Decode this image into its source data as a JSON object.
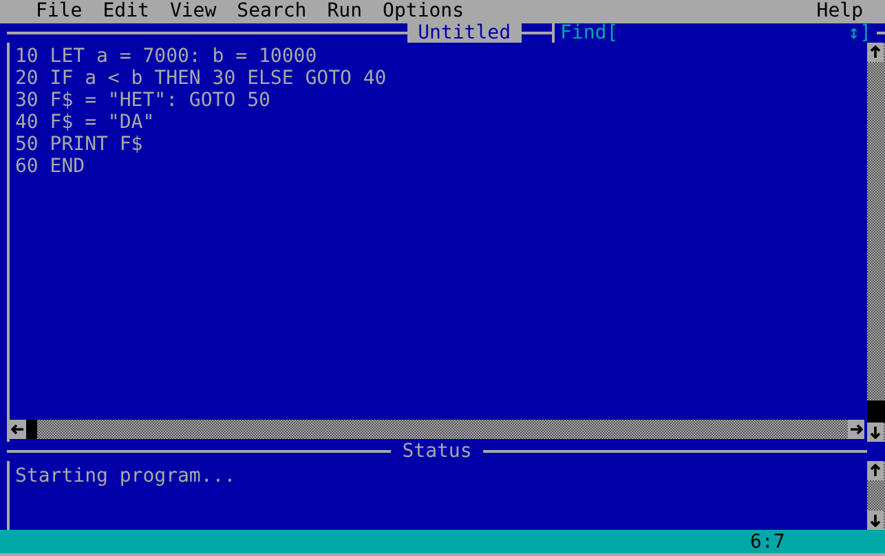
{
  "menu_bar": {
    "items": [
      "File",
      "Edit",
      "View",
      "Search",
      "Run",
      "Options"
    ],
    "help": "Help"
  },
  "editor": {
    "title": "Untitled",
    "find_label": "Find[",
    "find_end": "↕]",
    "lines": [
      "10 LET a = 7000: b = 10000",
      "20 IF a < b THEN 30 ELSE GOTO 40",
      "30 F$ = \"HET\": GOTO 50",
      "40 F$ = \"DA\"",
      "50 PRINT F$",
      "60 END"
    ]
  },
  "status_pane": {
    "title": "Status",
    "text": "Starting program..."
  },
  "status_bar": {
    "position": "6:7"
  }
}
